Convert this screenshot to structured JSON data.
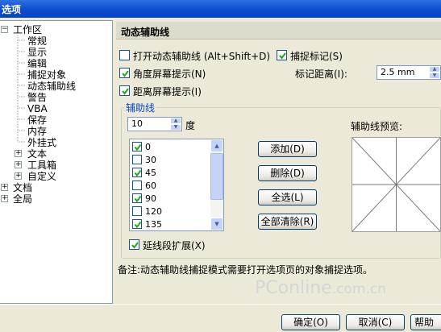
{
  "window": {
    "title": "选项"
  },
  "tree": {
    "items": [
      {
        "label": "工作区",
        "expander": "−"
      },
      {
        "label": "常规"
      },
      {
        "label": "显示"
      },
      {
        "label": "编辑"
      },
      {
        "label": "捕捉对象"
      },
      {
        "label": "动态辅助线",
        "selected": true
      },
      {
        "label": "警告"
      },
      {
        "label": "VBA"
      },
      {
        "label": "保存"
      },
      {
        "label": "内存"
      },
      {
        "label": "外挂式"
      },
      {
        "label": "文本",
        "expander": "+"
      },
      {
        "label": "工具箱",
        "expander": "+"
      },
      {
        "label": "自定义",
        "expander": "+"
      },
      {
        "label": "文档",
        "expander": "+"
      },
      {
        "label": "全局",
        "expander": "+"
      }
    ]
  },
  "panel": {
    "title": "动态辅助线",
    "enable_dynamic_guides": {
      "label": "打开动态辅助线 (Alt+Shift+D)",
      "checked": false
    },
    "snap_ticks": {
      "label": "捕捉标记(S)",
      "checked": true
    },
    "angle_screen_tip": {
      "label": "角度屏幕提示(N)",
      "checked": true
    },
    "tick_spacing": {
      "label": "标记距离(I):",
      "value": "2.5 mm"
    },
    "distance_screen_tip": {
      "label": "距离屏幕提示(I)",
      "checked": true
    },
    "guides_group": {
      "title": "辅助线",
      "angle_input": "10",
      "angle_unit": "度",
      "angles": [
        {
          "value": "0",
          "checked": true
        },
        {
          "value": "30",
          "checked": false
        },
        {
          "value": "45",
          "checked": true
        },
        {
          "value": "60",
          "checked": false
        },
        {
          "value": "90",
          "checked": true
        },
        {
          "value": "120",
          "checked": false
        },
        {
          "value": "135",
          "checked": true
        }
      ],
      "buttons": {
        "add": "添加(D)",
        "delete": "删除(D)",
        "select_all": "全选(L)",
        "clear_all": "全部清除(R)"
      },
      "extend_segment": {
        "label": "延线段扩展(X)",
        "checked": true
      },
      "preview_label": "辅助线预览:"
    },
    "note": "备注:动态辅助线捕捉模式需要打开选项页的对象捕捉选项。"
  },
  "footer": {
    "ok": "确定(O)",
    "cancel": "取消(C)",
    "help": "帮助"
  },
  "watermark": {
    "main": "PConline",
    "suffix": ".com.cn"
  },
  "colors": {
    "titlebar": "#0a4dcf",
    "face": "#ece9d8",
    "group_title": "#0046d5",
    "check": "#1ea81e"
  }
}
